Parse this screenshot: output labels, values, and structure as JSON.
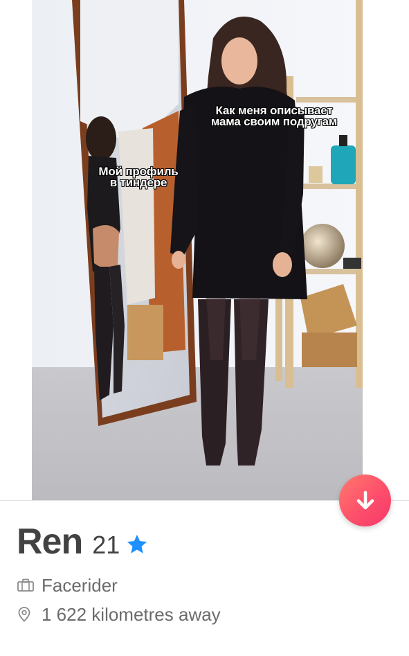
{
  "photo": {
    "caption_mom": [
      "Как меня описывает",
      "мама своим подругам"
    ],
    "caption_tinder": [
      "Мой профиль",
      "в тиндере"
    ]
  },
  "actions": {
    "dislike_icon": "arrow-down-icon",
    "accent_gradient": [
      "#ff7a6d",
      "#fd4f6b",
      "#f5376a"
    ]
  },
  "profile": {
    "name": "Ren",
    "age": "21",
    "verified_icon": "star-icon",
    "verified_color": "#1e90ff",
    "job_icon": "briefcase-icon",
    "job": "Facerider",
    "location_icon": "location-pin-icon",
    "distance": "1 622 kilometres away"
  }
}
